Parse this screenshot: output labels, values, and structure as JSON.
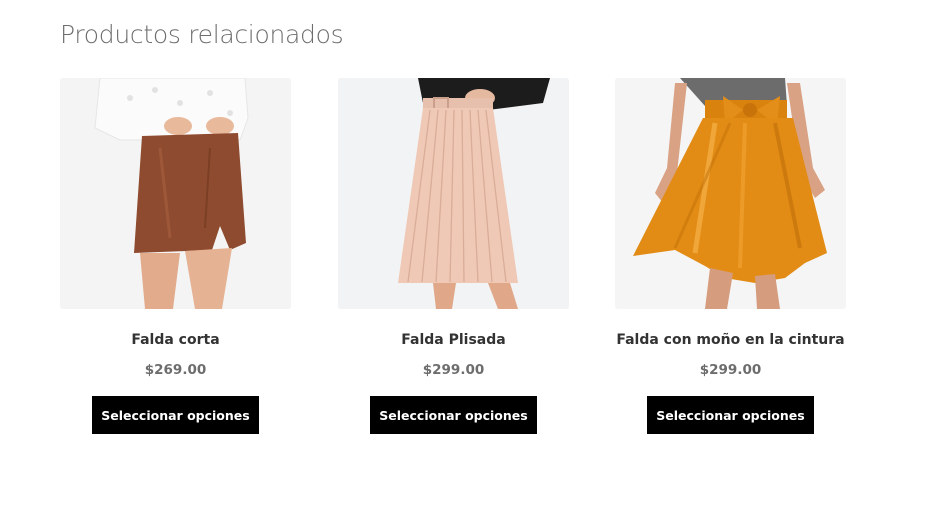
{
  "section": {
    "title": "Productos relacionados"
  },
  "products": [
    {
      "name": "Falda corta",
      "price": "$269.00",
      "button_label": "Seleccionar opciones",
      "image_desc": "brown-leather-mini-skirt"
    },
    {
      "name": "Falda Plisada",
      "price": "$299.00",
      "button_label": "Seleccionar opciones",
      "image_desc": "pink-pleated-midi-skirt"
    },
    {
      "name": "Falda con moño en la cintura",
      "price": "$299.00",
      "button_label": "Seleccionar opciones",
      "image_desc": "orange-satin-bow-skirt"
    }
  ],
  "colors": {
    "button_bg": "#000000",
    "button_text": "#ffffff",
    "title": "#6d6d6d",
    "price": "#6d6d6d"
  }
}
